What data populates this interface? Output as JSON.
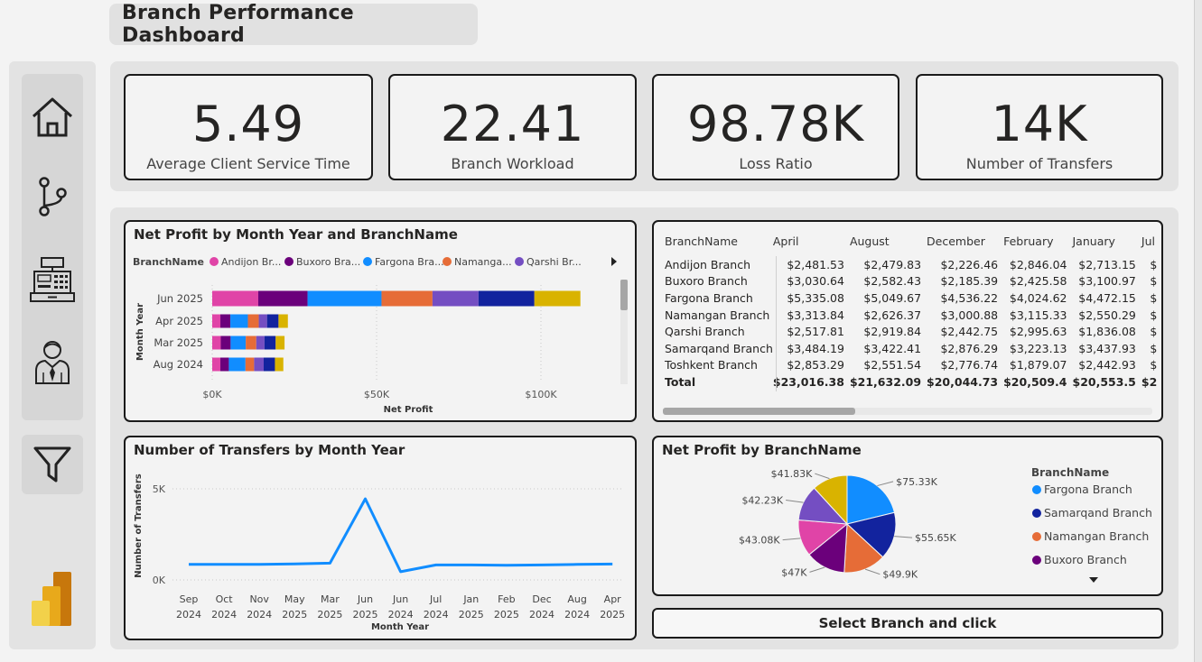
{
  "title": "Branch Performance Dashboard",
  "nav": {
    "items": [
      {
        "icon": "home-icon"
      },
      {
        "icon": "branch-icon"
      },
      {
        "icon": "cash-register-icon"
      },
      {
        "icon": "employee-icon"
      }
    ],
    "filter_icon": "filter-icon",
    "logo_icon": "power-bi-logo-icon"
  },
  "kpis": [
    {
      "value": "5.49",
      "label": "Average Client Service Time"
    },
    {
      "value": "22.41",
      "label": "Branch Workload"
    },
    {
      "value": "98.78K",
      "label": "Loss Ratio"
    },
    {
      "value": "14K",
      "label": "Number of Transfers"
    }
  ],
  "colors": {
    "Andijon Branch": "#e044a7",
    "Buxoro Branch": "#6b007b",
    "Fargona Branch": "#118dff",
    "Namangan Branch": "#e66c37",
    "Qarshi Branch": "#744ec2",
    "Samarqand Branch": "#12239e",
    "Toshkent Branch": "#d9b300"
  },
  "charts": {
    "bar": {
      "title": "Net Profit by Month Year and BranchName",
      "legend_title": "BranchName",
      "legend_items": [
        "Andijon Br...",
        "Buxoro Bra...",
        "Fargona Bra...",
        "Namanga...",
        "Qarshi Br..."
      ],
      "x_label": "Net Profit",
      "y_label": "Month Year"
    },
    "line": {
      "title": "Number of Transfers by Month Year",
      "y_label": "Number of Transfers",
      "x_label": "Month Year"
    },
    "pie": {
      "title": "Net Profit by BranchName",
      "legend_title": "BranchName",
      "legend_items": [
        "Fargona Branch",
        "Samarqand Branch",
        "Namangan Branch",
        "Buxoro Branch"
      ]
    }
  },
  "chart_data": [
    {
      "type": "bar",
      "orientation": "horizontal-stacked",
      "title": "Net Profit by Month Year and BranchName",
      "xlabel": "Net Profit",
      "ylabel": "Month Year",
      "x_ticks": [
        "$0K",
        "$50K",
        "$100K"
      ],
      "xlim": [
        0,
        120000
      ],
      "categories": [
        "Jun 2025",
        "Apr 2025",
        "Mar 2025",
        "Aug 2024"
      ],
      "series": [
        {
          "name": "Andijon Branch",
          "values": [
            14000,
            2481.53,
            2600,
            2479.83
          ]
        },
        {
          "name": "Buxoro Branch",
          "values": [
            15000,
            3030.64,
            3000,
            2582.43
          ]
        },
        {
          "name": "Fargona Branch",
          "values": [
            22500,
            5335.08,
            4600,
            5049.67
          ]
        },
        {
          "name": "Namangan Branch",
          "values": [
            15500,
            3313.84,
            3200,
            2626.37
          ]
        },
        {
          "name": "Qarshi Branch",
          "values": [
            14000,
            2517.81,
            2500,
            2919.84
          ]
        },
        {
          "name": "Samarqand Branch",
          "values": [
            17000,
            3484.19,
            3400,
            3422.41
          ]
        },
        {
          "name": "Toshkent Branch",
          "values": [
            14000,
            2853.29,
            2700,
            2551.54
          ]
        }
      ],
      "legend": "top"
    },
    {
      "type": "line",
      "title": "Number of Transfers by Month Year",
      "xlabel": "Month Year",
      "ylabel": "Number of Transfers",
      "y_ticks": [
        "0K",
        "5K"
      ],
      "ylim": [
        0,
        5500
      ],
      "categories": [
        [
          "Sep",
          "2024"
        ],
        [
          "Oct",
          "2024"
        ],
        [
          "Nov",
          "2024"
        ],
        [
          "May",
          "2025"
        ],
        [
          "Mar",
          "2025"
        ],
        [
          "Jun",
          "2025"
        ],
        [
          "Jun",
          "2024"
        ],
        [
          "Jul",
          "2024"
        ],
        [
          "Jan",
          "2025"
        ],
        [
          "Feb",
          "2025"
        ],
        [
          "Dec",
          "2024"
        ],
        [
          "Aug",
          "2024"
        ],
        [
          "Apr",
          "2025"
        ]
      ],
      "values": [
        850,
        850,
        850,
        880,
        920,
        4450,
        450,
        820,
        820,
        800,
        820,
        850,
        870
      ]
    },
    {
      "type": "pie",
      "title": "Net Profit by BranchName",
      "slices": [
        {
          "name": "Fargona Branch",
          "value": 75330,
          "label": "$75.33K"
        },
        {
          "name": "Samarqand Branch",
          "value": 55650,
          "label": "$55.65K"
        },
        {
          "name": "Namangan Branch",
          "value": 49900,
          "label": "$49.9K"
        },
        {
          "name": "Buxoro Branch",
          "value": 47000,
          "label": "$47K"
        },
        {
          "name": "Andijon Branch",
          "value": 43080,
          "label": "$43.08K"
        },
        {
          "name": "Qarshi Branch",
          "value": 42230,
          "label": "$42.23K"
        },
        {
          "name": "Toshkent Branch",
          "value": 41830,
          "label": "$41.83K"
        }
      ],
      "legend": "right"
    }
  ],
  "table": {
    "columns": [
      "BranchName",
      "April",
      "August",
      "December",
      "February",
      "January",
      "Jul"
    ],
    "rows": [
      [
        "Andijon Branch",
        "$2,481.53",
        "$2,479.83",
        "$2,226.46",
        "$2,846.04",
        "$2,713.15",
        "$"
      ],
      [
        "Buxoro Branch",
        "$3,030.64",
        "$2,582.43",
        "$2,185.39",
        "$2,425.58",
        "$3,100.97",
        "$"
      ],
      [
        "Fargona Branch",
        "$5,335.08",
        "$5,049.67",
        "$4,536.22",
        "$4,024.62",
        "$4,472.15",
        "$"
      ],
      [
        "Namangan Branch",
        "$3,313.84",
        "$2,626.37",
        "$3,000.88",
        "$3,115.33",
        "$2,550.29",
        "$"
      ],
      [
        "Qarshi Branch",
        "$2,517.81",
        "$2,919.84",
        "$2,442.75",
        "$2,995.63",
        "$1,836.08",
        "$"
      ],
      [
        "Samarqand Branch",
        "$3,484.19",
        "$3,422.41",
        "$2,876.29",
        "$3,223.13",
        "$3,437.93",
        "$"
      ],
      [
        "Toshkent Branch",
        "$2,853.29",
        "$2,551.54",
        "$2,776.74",
        "$1,879.07",
        "$2,442.93",
        "$"
      ]
    ],
    "total": [
      "Total",
      "$23,016.38",
      "$21,632.09",
      "$20,044.73",
      "$20,509.4",
      "$20,553.5",
      "$2"
    ]
  },
  "select_button": "Select Branch and click"
}
